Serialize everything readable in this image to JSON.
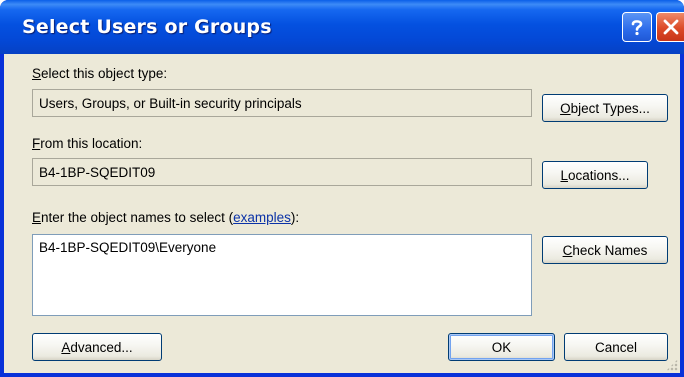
{
  "window": {
    "title": "Select Users or Groups"
  },
  "titlebar": {
    "help_icon": "question-mark-icon",
    "close_icon": "close-x-icon",
    "help_glyph": "?",
    "close_glyph": "✕"
  },
  "object_type": {
    "label_mnemonic": "S",
    "label_rest": "elect this object type:",
    "value": "Users, Groups, or Built-in security principals",
    "button_mnemonic": "O",
    "button_rest": "bject Types..."
  },
  "location": {
    "label_mnemonic": "F",
    "label_rest": "rom this location:",
    "value": "B4-1BP-SQEDIT09",
    "button_mnemonic": "L",
    "button_rest": "ocations..."
  },
  "names": {
    "label_mnemonic": "E",
    "label_rest": "nter the object names to select (",
    "label_link": "examples",
    "label_tail": "):",
    "value": "B4-1BP-SQEDIT09\\Everyone",
    "check_mnemonic": "C",
    "check_rest": "heck Names"
  },
  "footer": {
    "advanced_mnemonic": "A",
    "advanced_rest": "dvanced...",
    "ok_label": "OK",
    "cancel_label": "Cancel"
  },
  "colors": {
    "titlebar_blue": "#0451e0",
    "dialog_bg": "#ece9d8",
    "button_border": "#003c74",
    "close_red": "#dc4a27",
    "link_blue": "#0b32a7"
  }
}
